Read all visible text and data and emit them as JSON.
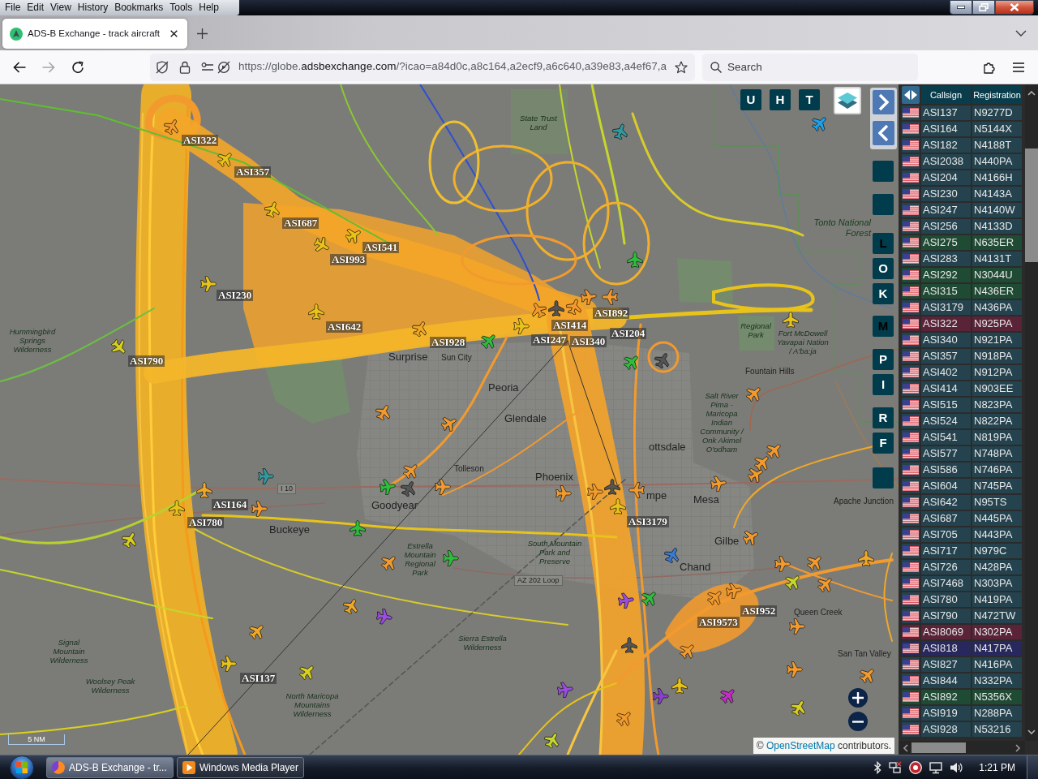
{
  "browser": {
    "menu": [
      "File",
      "Edit",
      "View",
      "History",
      "Bookmarks",
      "Tools",
      "Help"
    ],
    "tab": {
      "title": "ADS-B Exchange - track aircraft",
      "selected": true
    },
    "back": {
      "disabled": false
    },
    "forward": {
      "disabled": true
    },
    "url": {
      "prefix": "https://globe.",
      "domain": "adsbexchange.com",
      "rest": "/?icao=a84d0c,a8c164,a2ecf9,a6c640,a39e83,a4ef67,a"
    },
    "search": {
      "placeholder": "Search"
    }
  },
  "map": {
    "top_buttons": [
      {
        "label": "U",
        "on": false
      },
      {
        "label": "H",
        "on": false
      },
      {
        "label": "T",
        "on": false
      }
    ],
    "side_buttons": [
      {
        "kind": "blank"
      },
      {
        "kind": "blank"
      },
      {
        "kind": "letter",
        "label": "L",
        "on": true
      },
      {
        "kind": "letter",
        "label": "O",
        "on": false
      },
      {
        "kind": "letter",
        "label": "K",
        "on": false
      },
      {
        "kind": "letter",
        "label": "M",
        "on": true
      },
      {
        "kind": "letter",
        "label": "P",
        "on": false
      },
      {
        "kind": "letter",
        "label": "I",
        "on": false
      },
      {
        "kind": "letter",
        "label": "R",
        "on": false
      },
      {
        "kind": "letter",
        "label": "F",
        "on": false
      },
      {
        "kind": "blank"
      }
    ],
    "places": [
      {
        "name": "State Trust Land",
        "kind": "area"
      },
      {
        "name": "Tonto National Forest",
        "kind": "forest"
      },
      {
        "name": "Hummingbird Springs Wilderness",
        "kind": "area"
      },
      {
        "name": "Surprise",
        "kind": "city"
      },
      {
        "name": "Sun City",
        "kind": "small"
      },
      {
        "name": "Regional Park",
        "kind": "area"
      },
      {
        "name": "Fort McDowell Yavapai Nation / A'ba:ja",
        "kind": "area"
      },
      {
        "name": "Fountain Hills",
        "kind": "small"
      },
      {
        "name": "Peoria",
        "kind": "city"
      },
      {
        "name": "Glendale",
        "kind": "city"
      },
      {
        "name": "ottsdale",
        "kind": "city"
      },
      {
        "name": "Salt River Pima - Maricopa Indian Community / Onk Akimel O'odham",
        "kind": "area"
      },
      {
        "name": "Tolleson",
        "kind": "small"
      },
      {
        "name": "Phoenix",
        "kind": "city"
      },
      {
        "name": "I 10",
        "kind": "road"
      },
      {
        "name": "Goodyear",
        "kind": "city"
      },
      {
        "name": "mpe",
        "kind": "city"
      },
      {
        "name": "Mesa",
        "kind": "city"
      },
      {
        "name": "Apache Junction",
        "kind": "small"
      },
      {
        "name": "Buckeye",
        "kind": "city"
      },
      {
        "name": "Estrella Mountain Regional Park",
        "kind": "area"
      },
      {
        "name": "South Mountain Park and Preserve",
        "kind": "area"
      },
      {
        "name": "Gilbe",
        "kind": "city"
      },
      {
        "name": "Chand",
        "kind": "city"
      },
      {
        "name": "AZ 202 Loop",
        "kind": "road"
      },
      {
        "name": "Queen Creek",
        "kind": "small"
      },
      {
        "name": "Signal Mountain Wilderness",
        "kind": "area"
      },
      {
        "name": "Sierra Estrella Wilderness",
        "kind": "area"
      },
      {
        "name": "San Tan Valley",
        "kind": "small"
      },
      {
        "name": "Woolsey Peak Wilderness",
        "kind": "area"
      },
      {
        "name": "North Maricopa Mountains Wilderness",
        "kind": "area"
      }
    ],
    "aircraft": [
      {
        "color": "#f29a2e",
        "callsign": "ASI322"
      },
      {
        "color": "#e8c31a",
        "callsign": "ASI357"
      },
      {
        "color": "#e8c31a",
        "callsign": "ASI687"
      },
      {
        "color": "#e8c31a",
        "callsign": "ASI541"
      },
      {
        "color": "#e8c31a",
        "callsign": "ASI993"
      },
      {
        "color": "#e8c31a",
        "callsign": "ASI230"
      },
      {
        "color": "#e8c31a",
        "callsign": "ASI642"
      },
      {
        "color": "#d9d01e",
        "callsign": "ASI790"
      },
      {
        "color": "#f0a828",
        "callsign": "ASI928"
      },
      {
        "color": "#2fbe3c"
      },
      {
        "color": "#2f9aa0"
      },
      {
        "color": "#1da1e8"
      },
      {
        "color": "#2fbe3c"
      },
      {
        "color": "#f29a2e",
        "callsign": "ASI892"
      },
      {
        "color": "#f29a2e",
        "callsign": "ASI247"
      },
      {
        "color": "#555555",
        "callsign": "ASI340"
      },
      {
        "color": "#f29a2e",
        "callsign": "ASI414"
      },
      {
        "color": "#e8c31a"
      },
      {
        "color": "#f29a2e",
        "callsign": "ASI204"
      },
      {
        "color": "#2fbe3c"
      },
      {
        "color": "#555555"
      },
      {
        "color": "#e8c31a"
      },
      {
        "color": "#f29a2e"
      },
      {
        "color": "#f29a2e"
      },
      {
        "color": "#f29a2e"
      },
      {
        "color": "#f29a2e"
      },
      {
        "color": "#f29a2e"
      },
      {
        "color": "#2f9aa0"
      },
      {
        "color": "#f0a828"
      },
      {
        "color": "#f29a2e",
        "callsign": "ASI164"
      },
      {
        "color": "#e8c31a",
        "callsign": "ASI780"
      },
      {
        "color": "#2fbe3c"
      },
      {
        "color": "#555555"
      },
      {
        "color": "#2fbe3c"
      },
      {
        "color": "#d9d01e"
      },
      {
        "color": "#f29a2e"
      },
      {
        "color": "#f29a2e"
      },
      {
        "color": "#555555"
      },
      {
        "color": "#f29a2e"
      },
      {
        "color": "#e8c31a",
        "callsign": "ASI3179"
      },
      {
        "color": "#f29a2e"
      },
      {
        "color": "#f29a2e"
      },
      {
        "color": "#f29a2e"
      },
      {
        "color": "#f29a2e"
      },
      {
        "color": "#f29a2e"
      },
      {
        "color": "#3a7ad0"
      },
      {
        "color": "#f29a2e"
      },
      {
        "color": "#2fbe3c"
      },
      {
        "color": "#f0a828"
      },
      {
        "color": "#9b4de0"
      },
      {
        "color": "#f0a828"
      },
      {
        "color": "#d9d01e"
      },
      {
        "color": "#e8c31a",
        "callsign": "ASI137"
      },
      {
        "color": "#9b4de0"
      },
      {
        "color": "#2fbe3c"
      },
      {
        "color": "#f29a2e",
        "callsign": "ASI9573"
      },
      {
        "color": "#f29a2e",
        "callsign": "ASI952"
      },
      {
        "color": "#c6d62b"
      },
      {
        "color": "#f29a2e"
      },
      {
        "color": "#f29a2e"
      },
      {
        "color": "#f0a828"
      },
      {
        "color": "#f29a2e"
      },
      {
        "color": "#f29a2e"
      },
      {
        "color": "#555555"
      },
      {
        "color": "#f29a2e"
      },
      {
        "color": "#9b4de0"
      },
      {
        "color": "#8a3fd1"
      },
      {
        "color": "#c62bc6"
      },
      {
        "color": "#e8c31a"
      },
      {
        "color": "#f29a2e"
      },
      {
        "color": "#f29a2e"
      },
      {
        "color": "#d9d01e"
      },
      {
        "color": "#f29a2e"
      },
      {
        "color": "#c6d62b"
      }
    ],
    "scale": "5 NM",
    "attribution": {
      "prefix": "©",
      "link": "OpenStreetMap",
      "suffix": "contributors."
    }
  },
  "aircraft_table": {
    "columns": [
      "Callsign",
      "Registration"
    ],
    "rows": [
      {
        "callsign": "ASI137",
        "registration": "N9277D",
        "color": "#24434f"
      },
      {
        "callsign": "ASI164",
        "registration": "N5144X",
        "color": "#24434f"
      },
      {
        "callsign": "ASI182",
        "registration": "N4188T",
        "color": "#24434f"
      },
      {
        "callsign": "ASI2038",
        "registration": "N440PA",
        "color": "#24434f"
      },
      {
        "callsign": "ASI204",
        "registration": "N4166H",
        "color": "#24434f"
      },
      {
        "callsign": "ASI230",
        "registration": "N4143A",
        "color": "#24434f"
      },
      {
        "callsign": "ASI247",
        "registration": "N4140W",
        "color": "#24434f"
      },
      {
        "callsign": "ASI256",
        "registration": "N4133D",
        "color": "#24434f"
      },
      {
        "callsign": "ASI275",
        "registration": "N635ER",
        "color": "#1f4a33"
      },
      {
        "callsign": "ASI283",
        "registration": "N4131T",
        "color": "#24434f"
      },
      {
        "callsign": "ASI292",
        "registration": "N3044U",
        "color": "#1f4a33"
      },
      {
        "callsign": "ASI315",
        "registration": "N436ER",
        "color": "#1f4a33"
      },
      {
        "callsign": "ASI3179",
        "registration": "N436PA",
        "color": "#24434f"
      },
      {
        "callsign": "ASI322",
        "registration": "N925PA",
        "color": "#5a2338"
      },
      {
        "callsign": "ASI340",
        "registration": "N921PA",
        "color": "#24434f"
      },
      {
        "callsign": "ASI357",
        "registration": "N918PA",
        "color": "#24434f"
      },
      {
        "callsign": "ASI402",
        "registration": "N912PA",
        "color": "#24434f"
      },
      {
        "callsign": "ASI414",
        "registration": "N903EE",
        "color": "#24434f"
      },
      {
        "callsign": "ASI515",
        "registration": "N823PA",
        "color": "#24434f"
      },
      {
        "callsign": "ASI524",
        "registration": "N822PA",
        "color": "#24434f"
      },
      {
        "callsign": "ASI541",
        "registration": "N819PA",
        "color": "#24434f"
      },
      {
        "callsign": "ASI577",
        "registration": "N748PA",
        "color": "#24434f"
      },
      {
        "callsign": "ASI586",
        "registration": "N746PA",
        "color": "#24434f"
      },
      {
        "callsign": "ASI604",
        "registration": "N745PA",
        "color": "#24434f"
      },
      {
        "callsign": "ASI642",
        "registration": "N95TS",
        "color": "#24434f"
      },
      {
        "callsign": "ASI687",
        "registration": "N445PA",
        "color": "#24434f"
      },
      {
        "callsign": "ASI705",
        "registration": "N443PA",
        "color": "#24434f"
      },
      {
        "callsign": "ASI717",
        "registration": "N979C",
        "color": "#24434f"
      },
      {
        "callsign": "ASI726",
        "registration": "N428PA",
        "color": "#24434f"
      },
      {
        "callsign": "ASI7468",
        "registration": "N303PA",
        "color": "#24434f"
      },
      {
        "callsign": "ASI780",
        "registration": "N419PA",
        "color": "#24434f"
      },
      {
        "callsign": "ASI790",
        "registration": "N472TW",
        "color": "#24434f"
      },
      {
        "callsign": "ASI8069",
        "registration": "N302PA",
        "color": "#5a2338"
      },
      {
        "callsign": "ASI818",
        "registration": "N417PA",
        "color": "#28285e"
      },
      {
        "callsign": "ASI827",
        "registration": "N416PA",
        "color": "#24434f"
      },
      {
        "callsign": "ASI844",
        "registration": "N332PA",
        "color": "#24434f"
      },
      {
        "callsign": "ASI892",
        "registration": "N5356X",
        "color": "#1f4a33"
      },
      {
        "callsign": "ASI919",
        "registration": "N288PA",
        "color": "#24434f"
      },
      {
        "callsign": "ASI928",
        "registration": "N53216",
        "color": "#24434f"
      }
    ]
  },
  "taskbar": {
    "buttons": [
      {
        "label": "ADS-B Exchange - tr...",
        "kind": "browser",
        "selected": true
      },
      {
        "label": "Windows Media Player",
        "kind": "media",
        "selected": false
      }
    ],
    "clock": "1:21 PM"
  }
}
